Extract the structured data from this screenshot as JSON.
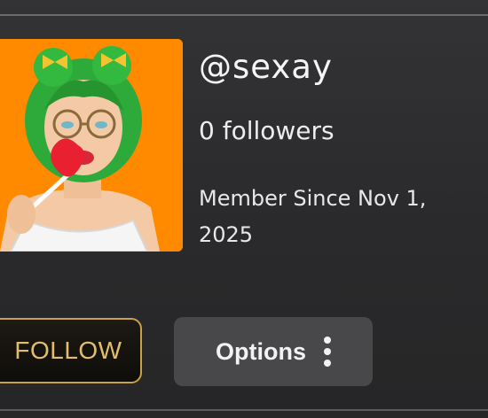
{
  "profile": {
    "username": "@sexay",
    "followers": "0 followers",
    "member_since": "Member Since Nov 1, 2025",
    "avatar_icon": "avatar-illustration"
  },
  "actions": {
    "follow_label": "FOLLOW",
    "options_label": "Options",
    "options_icon": "kebab-menu-icon"
  },
  "colors": {
    "background": "#2e2e30",
    "avatar_background": "#ff8a00",
    "follow_accent": "#e0be6e",
    "options_button": "#48484b"
  }
}
